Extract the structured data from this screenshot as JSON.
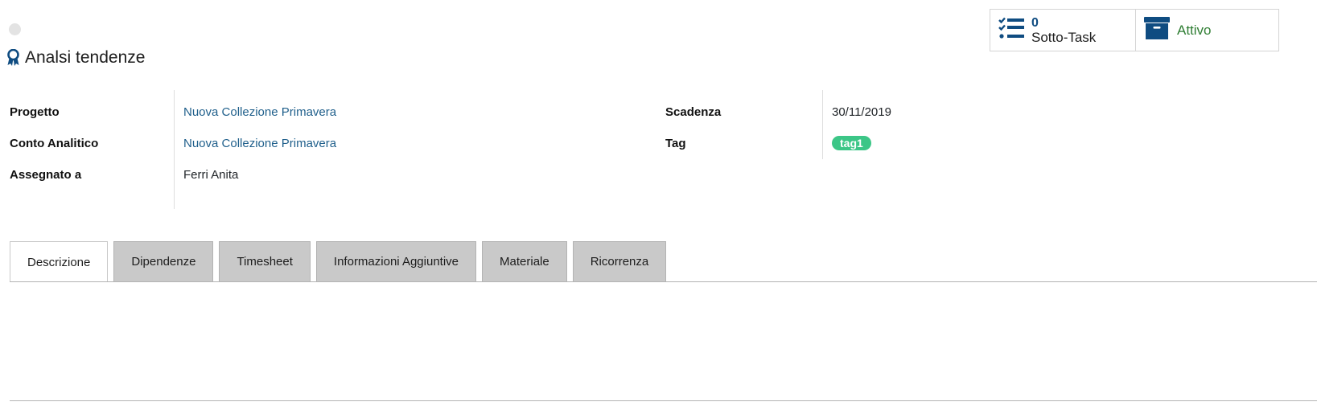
{
  "record": {
    "title": "Analsi tendenze",
    "status_dot_color": "#e3e3e3",
    "title_icon": "award-ribbon-icon"
  },
  "smart_buttons": {
    "subtask": {
      "count": "0",
      "label": "Sotto-Task",
      "icon": "checklist-icon"
    },
    "active": {
      "label": "Attivo",
      "icon": "archive-box-icon"
    }
  },
  "fields_left": {
    "project_label": "Progetto",
    "project_value": "Nuova Collezione Primavera",
    "analytic_label": "Conto Analitico",
    "analytic_value": "Nuova Collezione Primavera",
    "assigned_label": "Assegnato a",
    "assigned_value": "Ferri Anita"
  },
  "fields_right": {
    "deadline_label": "Scadenza",
    "deadline_value": "30/11/2019",
    "tag_label": "Tag",
    "tag_value": "tag1"
  },
  "tabs": [
    {
      "label": "Descrizione",
      "active": true
    },
    {
      "label": "Dipendenze",
      "active": false
    },
    {
      "label": "Timesheet",
      "active": false
    },
    {
      "label": "Informazioni Aggiuntive",
      "active": false
    },
    {
      "label": "Materiale",
      "active": false
    },
    {
      "label": "Ricorrenza",
      "active": false
    }
  ],
  "colors": {
    "accent": "#0f4c81",
    "link": "#1f5f8b",
    "active_green": "#2e7d32",
    "tag_green": "#3cc687",
    "tab_inactive_bg": "#c9c9c9"
  }
}
